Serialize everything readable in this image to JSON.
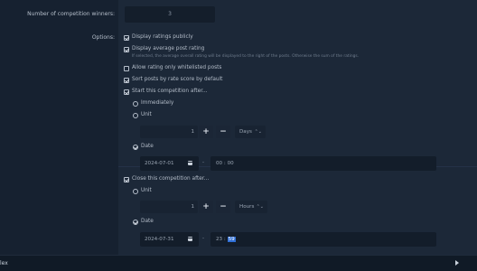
{
  "labels": {
    "winners": "Number of competition winners:",
    "options": "Options:"
  },
  "winners_value": "3",
  "options": {
    "display_ratings": "Display ratings publicly",
    "display_average": "Display average post rating",
    "display_average_hint": "If selected, the average overall rating will be displayed to the right of the posts. Otherwise the sum of the ratings.",
    "whitelisted_only": "Allow rating only whitelisted posts",
    "sort_by_rate": "Sort posts by rate score by default",
    "start_after": "Start this competition after...",
    "close_after": "Close this competition after..."
  },
  "start": {
    "immediately": "Immediately",
    "unit": "Unit",
    "amount": "1",
    "unit_value": "Days",
    "date_label": "Date",
    "date": "2024-07-01",
    "dash": "-",
    "hour": "00",
    "minute": "00"
  },
  "close": {
    "unit": "Unit",
    "amount": "1",
    "unit_value": "Hours",
    "date_label": "Date",
    "date": "2024-07-31",
    "dash": "-",
    "hour": "23",
    "minute": "59"
  },
  "controls": {
    "plus": "+",
    "minus": "−",
    "chevron": "⌃⌄"
  },
  "bottom_bar": {
    "label": "lex"
  }
}
